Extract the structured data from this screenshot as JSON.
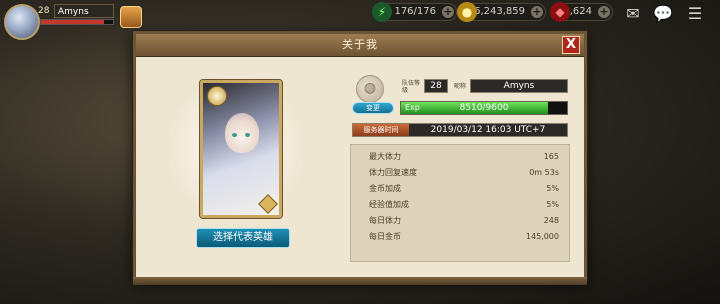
{
  "hud": {
    "level": "28",
    "player_name": "Amyns",
    "resources": {
      "energy": "176/176",
      "gold": "76,243,859",
      "gems": "4,624"
    }
  },
  "dialog": {
    "title": "关于我",
    "close_label": "X",
    "team_level_label": "队伍等级",
    "team_level": "28",
    "nickname_label": "昵称",
    "nickname": "Amyns",
    "change_label": "变更",
    "exp_label": "Exp",
    "exp_value": "8510/9600",
    "exp_progress": 0.886,
    "server_time_label": "服务器时间",
    "server_time": "2019/03/12 16:03 UTC+7",
    "select_hero_label": "选择代表英雄",
    "stats": [
      {
        "label": "最大体力",
        "value": "165"
      },
      {
        "label": "体力回复速度",
        "value": "0m 53s"
      },
      {
        "label": "金币加成",
        "value": "5%"
      },
      {
        "label": "经验值加成",
        "value": "5%"
      },
      {
        "label": "每日体力",
        "value": "248"
      },
      {
        "label": "每日金币",
        "value": "145,000"
      }
    ]
  },
  "colors": {
    "dialog_bg": "#efe6d2",
    "header": "#7e6441",
    "exp_fill": "#3fbf3a",
    "accent_blue": "#1f8fb3",
    "close_red": "#b0261d"
  }
}
